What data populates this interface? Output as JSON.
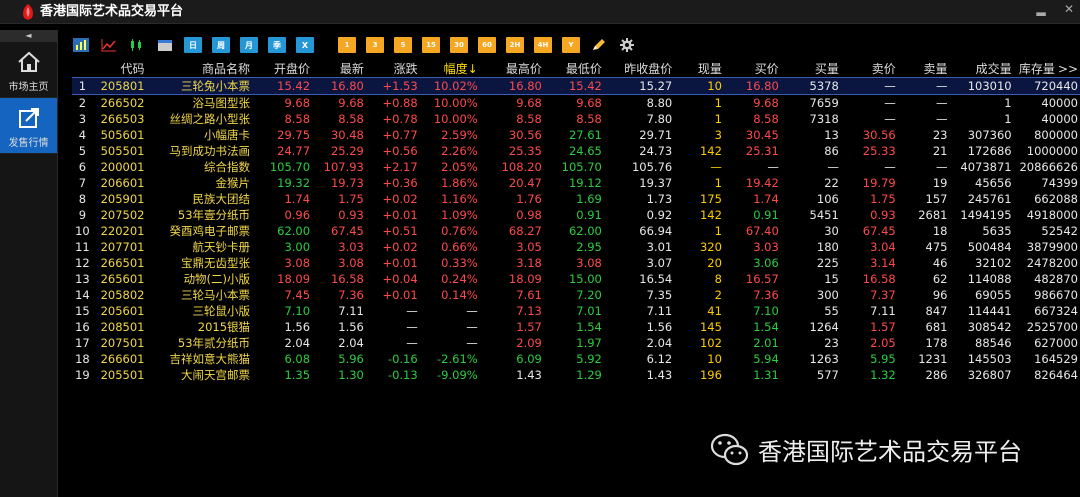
{
  "app": {
    "title": "香港国际艺术品交易平台"
  },
  "window_controls": [
    "▂",
    "✕"
  ],
  "sidebar": {
    "collapse": "◄",
    "items": [
      {
        "label": "市场主页",
        "icon": "home-icon",
        "active": false
      },
      {
        "label": "发售行情",
        "icon": "export-icon",
        "active": true
      }
    ]
  },
  "toolbar": {
    "buttons": [
      {
        "name": "bar-chart-icon",
        "text": "",
        "style": "icon"
      },
      {
        "name": "line-chart-icon",
        "text": "",
        "style": "icon"
      },
      {
        "name": "candlestick-icon",
        "text": "",
        "style": "icon"
      },
      {
        "name": "calendar-icon",
        "text": "",
        "style": "icon"
      },
      {
        "name": "period-day-button",
        "text": "日",
        "style": "blue"
      },
      {
        "name": "period-week-button",
        "text": "周",
        "style": "blue"
      },
      {
        "name": "period-month-button",
        "text": "月",
        "style": "blue"
      },
      {
        "name": "period-quarter-button",
        "text": "季",
        "style": "blue"
      },
      {
        "name": "excel-button",
        "text": "X",
        "style": "blue"
      },
      {
        "name": "min1-button",
        "text": "1",
        "style": "orange"
      },
      {
        "name": "min3-button",
        "text": "3",
        "style": "orange"
      },
      {
        "name": "min5-button",
        "text": "5",
        "style": "orange"
      },
      {
        "name": "min15-button",
        "text": "15",
        "style": "orange"
      },
      {
        "name": "min30-button",
        "text": "30",
        "style": "orange"
      },
      {
        "name": "min60-button",
        "text": "60",
        "style": "orange"
      },
      {
        "name": "hour2-button",
        "text": "2H",
        "style": "orange"
      },
      {
        "name": "hour4-button",
        "text": "4H",
        "style": "orange"
      },
      {
        "name": "year-button",
        "text": "Y",
        "style": "orange"
      },
      {
        "name": "pencil-icon",
        "text": "",
        "style": "icon"
      },
      {
        "name": "gear-icon",
        "text": "",
        "style": "icon"
      }
    ]
  },
  "table": {
    "columns": [
      "",
      "代码",
      "商品名称",
      "开盘价",
      "最新",
      "涨跌",
      "幅度↓",
      "最高价",
      "最低价",
      "昨收盘价",
      "现量",
      "买价",
      "买量",
      "卖价",
      "卖量",
      "成交量",
      "库存量"
    ],
    "more": ">>",
    "rows": [
      [
        "1",
        "205801",
        "三轮兔小本票",
        "15.42",
        "16.80",
        "+1.53",
        "10.02%",
        "16.80",
        "15.42",
        "15.27",
        "10",
        "16.80",
        "5378",
        "—",
        "—",
        "103010",
        "720440"
      ],
      [
        "2",
        "266502",
        "浴马图型张",
        "9.68",
        "9.68",
        "+0.88",
        "10.00%",
        "9.68",
        "9.68",
        "8.80",
        "1",
        "9.68",
        "7659",
        "—",
        "—",
        "1",
        "40000"
      ],
      [
        "3",
        "266503",
        "丝绸之路小型张",
        "8.58",
        "8.58",
        "+0.78",
        "10.00%",
        "8.58",
        "8.58",
        "7.80",
        "1",
        "8.58",
        "7318",
        "—",
        "—",
        "1",
        "40000"
      ],
      [
        "4",
        "505601",
        "小幅唐卡",
        "29.75",
        "30.48",
        "+0.77",
        "2.59%",
        "30.56",
        "27.61",
        "29.71",
        "3",
        "30.45",
        "13",
        "30.56",
        "23",
        "307360",
        "800000"
      ],
      [
        "5",
        "505501",
        "马到成功书法画",
        "24.77",
        "25.29",
        "+0.56",
        "2.26%",
        "25.35",
        "24.65",
        "24.73",
        "142",
        "25.31",
        "86",
        "25.33",
        "21",
        "172686",
        "1000000"
      ],
      [
        "6",
        "200001",
        "综合指数",
        "105.70",
        "107.93",
        "+2.17",
        "2.05%",
        "108.20",
        "105.70",
        "105.76",
        "—",
        "—",
        "—",
        "—",
        "—",
        "4073871",
        "20866626"
      ],
      [
        "7",
        "206601",
        "金猴片",
        "19.32",
        "19.73",
        "+0.36",
        "1.86%",
        "20.47",
        "19.12",
        "19.37",
        "1",
        "19.42",
        "22",
        "19.79",
        "19",
        "45656",
        "74399"
      ],
      [
        "8",
        "205901",
        "民族大团结",
        "1.74",
        "1.75",
        "+0.02",
        "1.16%",
        "1.76",
        "1.69",
        "1.73",
        "175",
        "1.74",
        "106",
        "1.75",
        "157",
        "245761",
        "662088"
      ],
      [
        "9",
        "207502",
        "53年壹分纸币",
        "0.96",
        "0.93",
        "+0.01",
        "1.09%",
        "0.98",
        "0.91",
        "0.92",
        "142",
        "0.91",
        "5451",
        "0.93",
        "2681",
        "1494195",
        "4918000"
      ],
      [
        "10",
        "220201",
        "癸酉鸡电子邮票",
        "62.00",
        "67.45",
        "+0.51",
        "0.76%",
        "68.27",
        "62.00",
        "66.94",
        "1",
        "67.40",
        "30",
        "67.45",
        "18",
        "5635",
        "52542"
      ],
      [
        "11",
        "207701",
        "航天钞卡册",
        "3.00",
        "3.03",
        "+0.02",
        "0.66%",
        "3.05",
        "2.95",
        "3.01",
        "320",
        "3.03",
        "180",
        "3.04",
        "475",
        "500484",
        "3879900"
      ],
      [
        "12",
        "266501",
        "宝鼎无齿型张",
        "3.08",
        "3.08",
        "+0.01",
        "0.33%",
        "3.18",
        "3.08",
        "3.07",
        "20",
        "3.06",
        "225",
        "3.14",
        "46",
        "32102",
        "2478200"
      ],
      [
        "13",
        "265601",
        "动物(二)小版",
        "18.09",
        "16.58",
        "+0.04",
        "0.24%",
        "18.09",
        "15.00",
        "16.54",
        "8",
        "16.57",
        "15",
        "16.58",
        "62",
        "114088",
        "482870"
      ],
      [
        "14",
        "205802",
        "三轮马小本票",
        "7.45",
        "7.36",
        "+0.01",
        "0.14%",
        "7.61",
        "7.20",
        "7.35",
        "2",
        "7.36",
        "300",
        "7.37",
        "96",
        "69055",
        "986670"
      ],
      [
        "15",
        "205601",
        "三轮鼠小版",
        "7.10",
        "7.11",
        "—",
        "—",
        "7.13",
        "7.01",
        "7.11",
        "41",
        "7.10",
        "55",
        "7.11",
        "847",
        "114441",
        "667324"
      ],
      [
        "16",
        "208501",
        "2015银猫",
        "1.56",
        "1.56",
        "—",
        "—",
        "1.57",
        "1.54",
        "1.56",
        "145",
        "1.54",
        "1264",
        "1.57",
        "681",
        "308542",
        "2525700"
      ],
      [
        "17",
        "207501",
        "53年贰分纸币",
        "2.04",
        "2.04",
        "—",
        "—",
        "2.09",
        "1.97",
        "2.04",
        "102",
        "2.01",
        "23",
        "2.05",
        "178",
        "88546",
        "627000"
      ],
      [
        "18",
        "266601",
        "吉祥如意大熊猫",
        "6.08",
        "5.96",
        "-0.16",
        "-2.61%",
        "6.09",
        "5.92",
        "6.12",
        "10",
        "5.94",
        "1263",
        "5.95",
        "1231",
        "145503",
        "164529"
      ],
      [
        "19",
        "205501",
        "大闹天宫邮票",
        "1.35",
        "1.30",
        "-0.13",
        "-9.09%",
        "1.43",
        "1.29",
        "1.43",
        "196",
        "1.31",
        "577",
        "1.32",
        "286",
        "326807",
        "826464"
      ]
    ],
    "colors": {
      "up": "#ff4a4a",
      "down": "#2ecc40",
      "flat": "#e8e8e8",
      "name": "#f0d648",
      "qty": "#ffcc00"
    }
  },
  "watermark": {
    "text": "香港国际艺术品交易平台",
    "icon": "wechat-icon"
  }
}
